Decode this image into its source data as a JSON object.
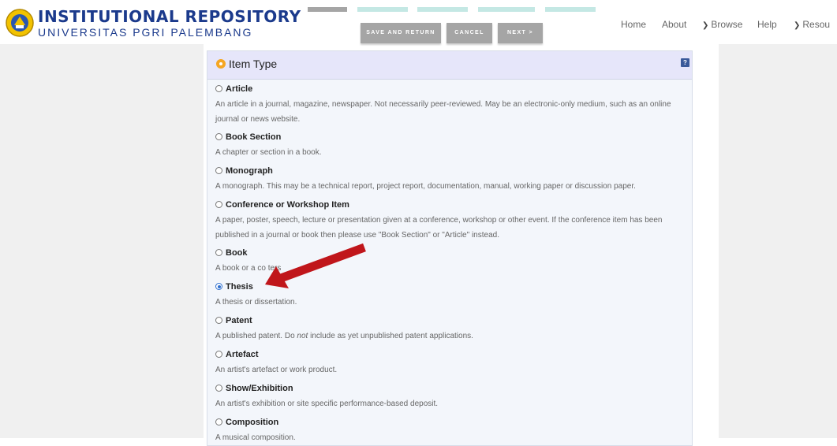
{
  "header": {
    "brand_title": "INSTITUTIONAL REPOSITORY",
    "brand_subtitle": "UNIVERSITAS PGRI PALEMBANG"
  },
  "workflow": {
    "buttons": {
      "save": "SAVE AND RETURN",
      "cancel": "CANCEL",
      "next": "NEXT >"
    },
    "progress_colors": [
      "#a5a5a5",
      "#c4e8e4",
      "#c4e8e4",
      "#c4e8e4",
      "#c4e8e4"
    ]
  },
  "nav": {
    "home": "Home",
    "about": "About",
    "browse": "Browse",
    "help": "Help",
    "resources": "Resou"
  },
  "panel": {
    "title": "Item Type",
    "help_icon": "?",
    "options": [
      {
        "title": "Article",
        "desc": "An article in a journal, magazine, newspaper. Not necessarily peer-reviewed. May be an electronic-only medium, such as an online journal or news website.",
        "selected": false
      },
      {
        "title": "Book Section",
        "desc": "A chapter or section in a book.",
        "selected": false
      },
      {
        "title": "Monograph",
        "desc": "A monograph. This may be a technical report, project report, documentation, manual, working paper or discussion paper.",
        "selected": false
      },
      {
        "title": "Conference or Workshop Item",
        "desc": "A paper, poster, speech, lecture or presentation given at a conference, workshop or other event. If the conference item has been published in a journal or book then please use \"Book Section\" or \"Article\" instead.",
        "selected": false
      },
      {
        "title": "Book",
        "desc": "A book or a co   ",
        "desc_suffix": "ters",
        "selected": false
      },
      {
        "title": "Thesis",
        "desc": "A thesis or dissertation.",
        "selected": true
      },
      {
        "title": "Patent",
        "desc_before": "A published patent. Do ",
        "desc_em": "not",
        "desc_after": " include as yet unpublished patent applications.",
        "selected": false
      },
      {
        "title": "Artefact",
        "desc": "An artist's artefact or work product.",
        "selected": false
      },
      {
        "title": "Show/Exhibition",
        "desc": "An artist's exhibition or site specific performance-based deposit.",
        "selected": false
      },
      {
        "title": "Composition",
        "desc": "A musical composition.",
        "selected": false
      }
    ]
  },
  "annotation": {
    "arrow_color": "#c0161b"
  }
}
